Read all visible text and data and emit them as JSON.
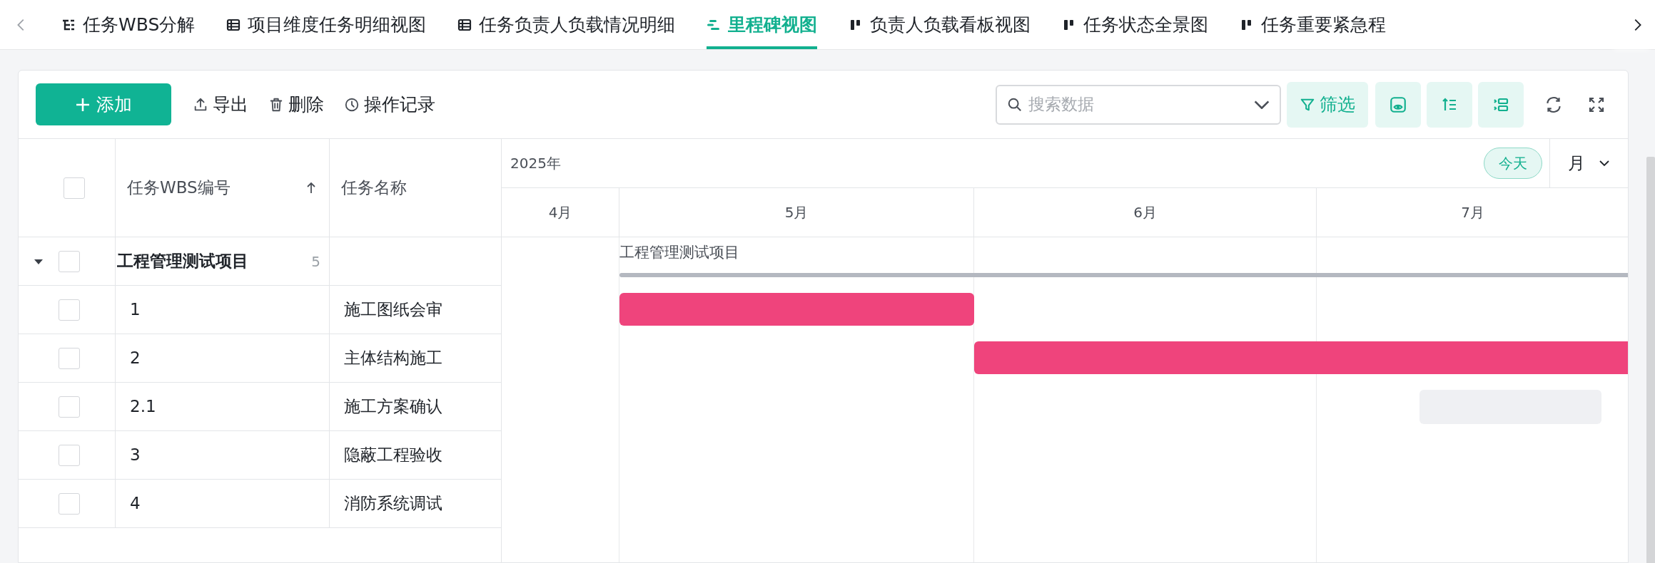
{
  "tabs": [
    {
      "label": "任务WBS分解",
      "kind": "tree",
      "selected": false
    },
    {
      "label": "项目维度任务明细视图",
      "kind": "table",
      "selected": false
    },
    {
      "label": "任务负责人负载情况明细",
      "kind": "table",
      "selected": false
    },
    {
      "label": "里程碑视图",
      "kind": "gantt",
      "selected": true
    },
    {
      "label": "负责人负载看板视图",
      "kind": "board",
      "selected": false
    },
    {
      "label": "任务状态全景图",
      "kind": "board",
      "selected": false
    },
    {
      "label": "任务重要紧急程",
      "kind": "board",
      "selected": false
    }
  ],
  "toolbar": {
    "add_button": "添加",
    "actions": [
      {
        "label": "导出",
        "kind": "export"
      },
      {
        "label": "删除",
        "kind": "delete"
      },
      {
        "label": "操作记录",
        "kind": "history"
      }
    ],
    "search": {
      "placeholder": "搜索数据"
    },
    "filter_button": "筛选"
  },
  "table": {
    "select_all_checked": false,
    "columns": [
      {
        "label": "任务WBS编号",
        "sorted": true
      },
      {
        "label": "任务名称",
        "sorted": false
      }
    ],
    "group": {
      "name": "工程管理测试项目",
      "count": "5",
      "expanded": true,
      "checked": false
    },
    "rows": [
      {
        "wbs": "1",
        "name": "施工图纸会审",
        "checked": false,
        "kind": "task"
      },
      {
        "wbs": "2",
        "name": "主体结构施工",
        "checked": false,
        "kind": "task"
      },
      {
        "wbs": "2.1",
        "name": "施工方案确认",
        "checked": false,
        "kind": "pending"
      },
      {
        "wbs": "3",
        "name": "隐蔽工程验收",
        "checked": false,
        "kind": "unscheduled"
      },
      {
        "wbs": "4",
        "name": "消防系统调试",
        "checked": false,
        "kind": "unscheduled"
      }
    ]
  },
  "gantt": {
    "year": "2025年",
    "today_button": "今天",
    "scale": "月",
    "months": [
      "4月",
      "5月",
      "6月",
      "7月"
    ],
    "summary_label": "工程管理测试项目"
  }
}
